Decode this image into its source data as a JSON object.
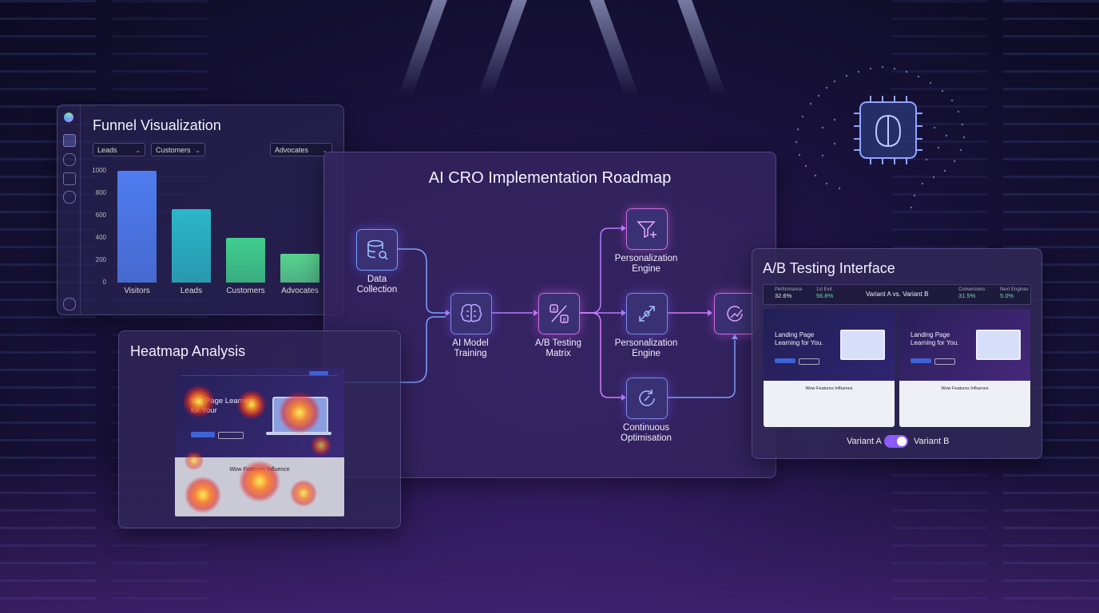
{
  "funnel": {
    "title": "Funnel Visualization",
    "filters": [
      "Leads",
      "Customers",
      "Advocates"
    ],
    "sidebar_icons": [
      "logo-icon",
      "database-icon",
      "users-icon",
      "briefcase-icon",
      "settings-icon",
      "gear-icon"
    ],
    "chart_data": {
      "type": "bar",
      "categories": [
        "Visitors",
        "Leads",
        "Customers",
        "Advocates"
      ],
      "values": [
        1000,
        660,
        400,
        260
      ],
      "yticks": [
        "1000",
        "800",
        "600",
        "400",
        "200",
        "0"
      ],
      "ylim": [
        0,
        1000
      ],
      "colors": [
        "#4f7cf0",
        "#2bb7c9",
        "#3fcf8e",
        "#58d48f"
      ],
      "grid": false
    }
  },
  "roadmap": {
    "title": "AI CRO Implementation Roadmap",
    "nodes": {
      "data": "Data Collection",
      "model": "AI Model Training",
      "ab": "A/B Testing Matrix",
      "pers_top": "Personalization Engine",
      "pers_mid": "Personalization Engine",
      "opt": "Continuous Optimisation"
    },
    "icons": [
      "database-icon",
      "brain-icon",
      "ab-matrix-icon",
      "funnel-icon",
      "target-icon",
      "refresh-icon",
      "analytics-icon"
    ]
  },
  "heatmap": {
    "title": "Heatmap Analysis",
    "headline": "ting Page Learning for Your",
    "section": "Wow Features Influence"
  },
  "ab_test": {
    "title": "A/B Testing Interface",
    "stats": [
      {
        "label": "Performance",
        "value": "32.6%"
      },
      {
        "label": "1st Exit",
        "value": "56.8%"
      },
      {
        "label": "Conversions",
        "value": "31.5%"
      },
      {
        "label": "Next Engines",
        "value": "5.0%"
      }
    ],
    "comparison": "Variant A vs. Variant B",
    "variant_a": {
      "headline": "Landing Page Learning for You.",
      "section": "Wow Features Influence"
    },
    "variant_b": {
      "headline": "Landing Page Learning for You.",
      "section": "Wow Features Influence"
    },
    "toggle_left": "Variant A",
    "toggle_right": "Variant B",
    "toggle_on": true
  }
}
